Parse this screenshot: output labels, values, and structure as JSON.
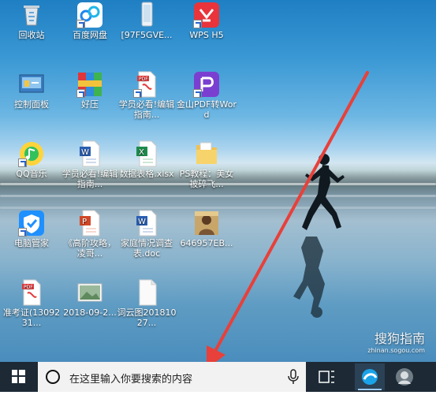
{
  "desktop": {
    "icons": [
      {
        "label": "回收站",
        "icon": "recycle-bin-icon"
      },
      {
        "label": "百度网盘",
        "icon": "baidu-netdisk-icon"
      },
      {
        "label": "[97F5GVE...",
        "icon": "phone-image-icon"
      },
      {
        "label": "WPS H5",
        "icon": "wps-h5-icon"
      },
      {
        "label": "控制面板",
        "icon": "control-panel-icon"
      },
      {
        "label": "好压",
        "icon": "haozip-icon"
      },
      {
        "label": "学员必看!编辑指南...",
        "icon": "pdf-file-icon"
      },
      {
        "label": "金山PDF转Word",
        "icon": "kingsoft-pdf-icon"
      },
      {
        "label": "QQ音乐",
        "icon": "qq-music-icon"
      },
      {
        "label": "学员必看!编辑指南...",
        "icon": "word-file-icon"
      },
      {
        "label": "数据表格.xlsx",
        "icon": "excel-file-icon"
      },
      {
        "label": "PS教程：美女被碎飞...",
        "icon": "folder-icon"
      },
      {
        "label": "电脑管家",
        "icon": "pc-manager-icon"
      },
      {
        "label": "《高阶攻略，凌哥...",
        "icon": "ppt-file-icon"
      },
      {
        "label": "家庭情况调查表.doc",
        "icon": "word-doc-icon"
      },
      {
        "label": "646957EB...",
        "icon": "photo-icon"
      },
      {
        "label": "准考证(1309231...",
        "icon": "pdf-file-icon"
      },
      {
        "label": "2018-09-2...",
        "icon": "photo-thumb-icon"
      },
      {
        "label": "词云图20181027...",
        "icon": "blank-image-icon"
      }
    ]
  },
  "taskbar": {
    "search_placeholder": "在这里输入你要搜索的内容"
  },
  "watermark": {
    "brand": "搜狗指南",
    "url": "zhinan.sogou.com"
  },
  "colors": {
    "taskbar": "#1d2a35",
    "arrow": "#e8403a",
    "start": "#ffffff"
  }
}
